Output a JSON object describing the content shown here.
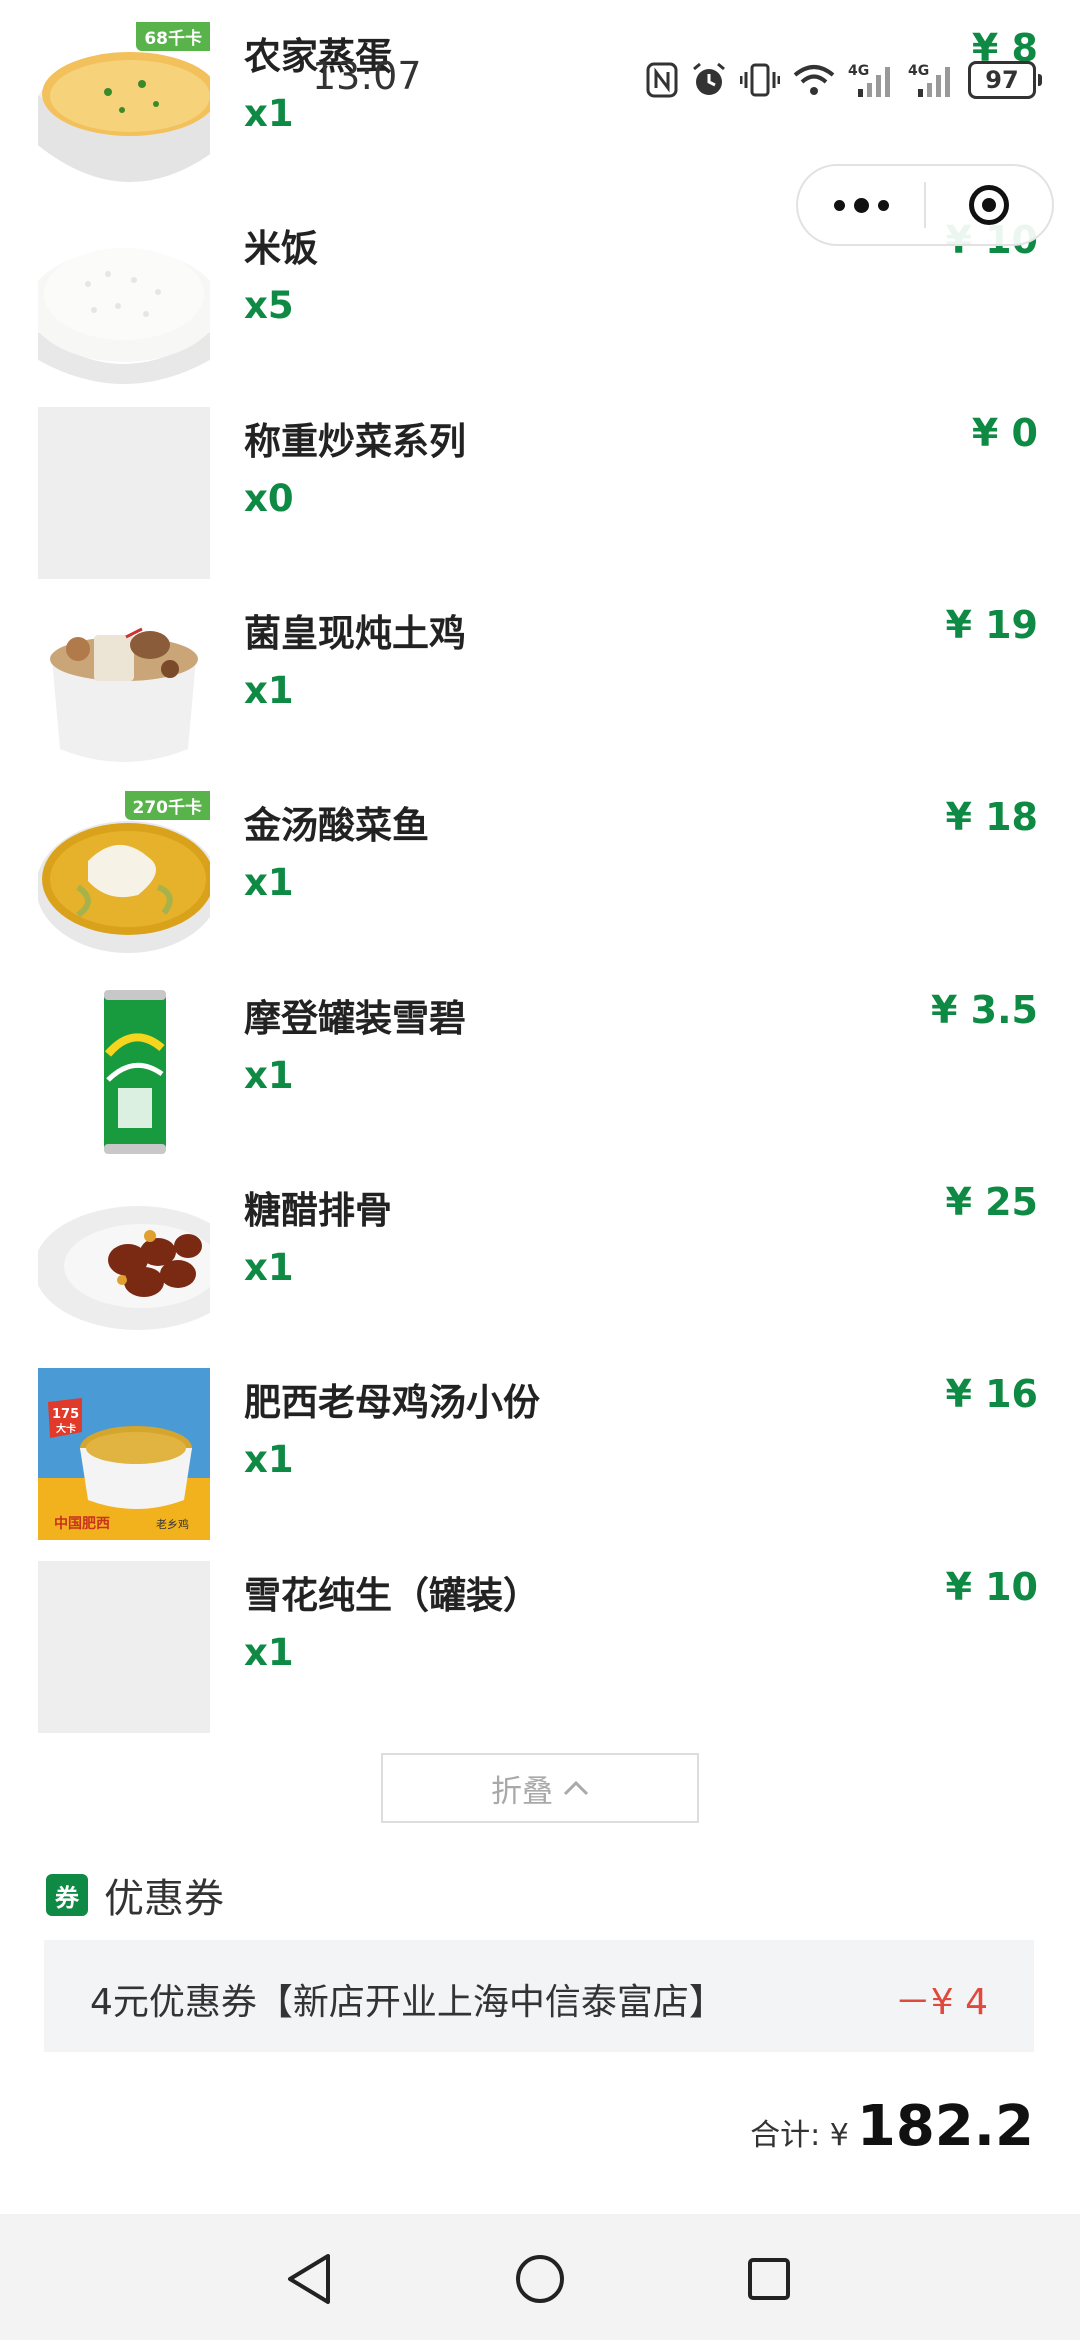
{
  "status_bar": {
    "time": "13:07",
    "battery": "97"
  },
  "capsule": {
    "more_icon": "more-dots-icon",
    "close_icon": "target-close-icon"
  },
  "items": [
    {
      "name": "农家蒸蛋",
      "qty": "x1",
      "price": "¥ 8",
      "kcal": "68千卡"
    },
    {
      "name": "米饭",
      "qty": "x5",
      "price": "¥ 10"
    },
    {
      "name": "称重炒菜系列",
      "qty": "x0",
      "price": "¥ 0"
    },
    {
      "name": "菌皇现炖土鸡",
      "qty": "x1",
      "price": "¥ 19"
    },
    {
      "name": "金汤酸菜鱼",
      "qty": "x1",
      "price": "¥ 18",
      "kcal": "270千卡"
    },
    {
      "name": "摩登罐装雪碧",
      "qty": "x1",
      "price": "¥ 3.5"
    },
    {
      "name": "糖醋排骨",
      "qty": "x1",
      "price": "¥ 25"
    },
    {
      "name": "肥西老母鸡汤小份",
      "qty": "x1",
      "price": "¥ 16",
      "badge": "175\n大卡",
      "banner_left": "中国肥西",
      "banner_right": "老乡鸡"
    },
    {
      "name": "雪花纯生（罐装）",
      "qty": "x1",
      "price": "¥ 10"
    }
  ],
  "collapse": {
    "label": "折叠"
  },
  "coupon": {
    "icon_label": "券",
    "title": "优惠券",
    "name": "4元优惠券【新店开业上海中信泰富店】",
    "value": "－¥ 4"
  },
  "total": {
    "label": "合计: ¥",
    "value": "182.2"
  },
  "colors": {
    "accent": "#0e8a44",
    "discount": "#e04a3c"
  }
}
